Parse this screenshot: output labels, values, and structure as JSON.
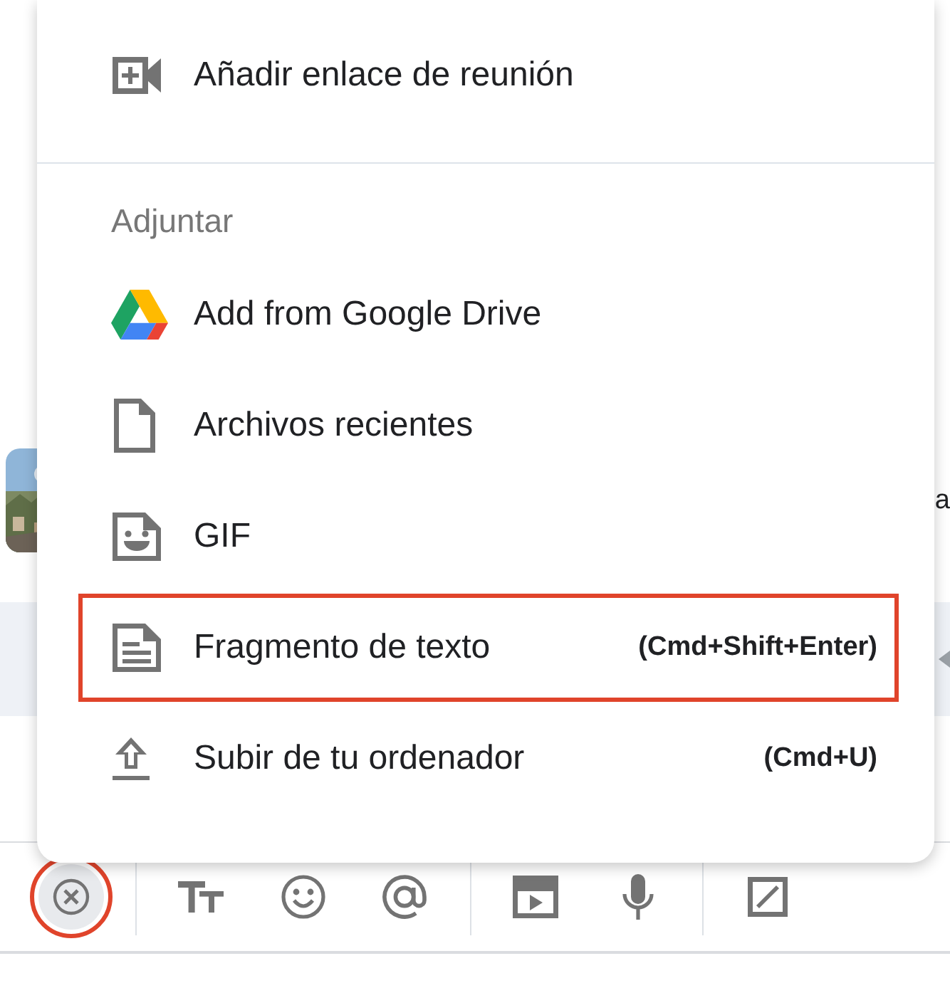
{
  "background": {
    "message_text": "a"
  },
  "menu": {
    "top_item": {
      "kind": "video",
      "label": "Añadir enlace de reunión"
    },
    "section_title": "Adjuntar",
    "items": [
      {
        "kind": "drive",
        "label": "Add from Google Drive",
        "highlighted": false
      },
      {
        "kind": "file",
        "label": "Archivos recientes",
        "highlighted": false
      },
      {
        "kind": "gif",
        "label": "GIF",
        "highlighted": false
      },
      {
        "kind": "snippet",
        "label": "Fragmento de texto",
        "shortcut": "(Cmd+Shift+Enter)",
        "highlighted": true
      },
      {
        "kind": "upload",
        "label": "Subir de tu ordenador",
        "shortcut": "(Cmd+U)",
        "highlighted": false
      }
    ]
  },
  "toolbar": {
    "groups": [
      [
        {
          "kind": "close",
          "highlighted": true
        }
      ],
      [
        {
          "kind": "format"
        },
        {
          "kind": "emoji"
        },
        {
          "kind": "mention"
        }
      ],
      [
        {
          "kind": "video-clip"
        },
        {
          "kind": "mic"
        }
      ],
      [
        {
          "kind": "slash"
        }
      ]
    ]
  }
}
